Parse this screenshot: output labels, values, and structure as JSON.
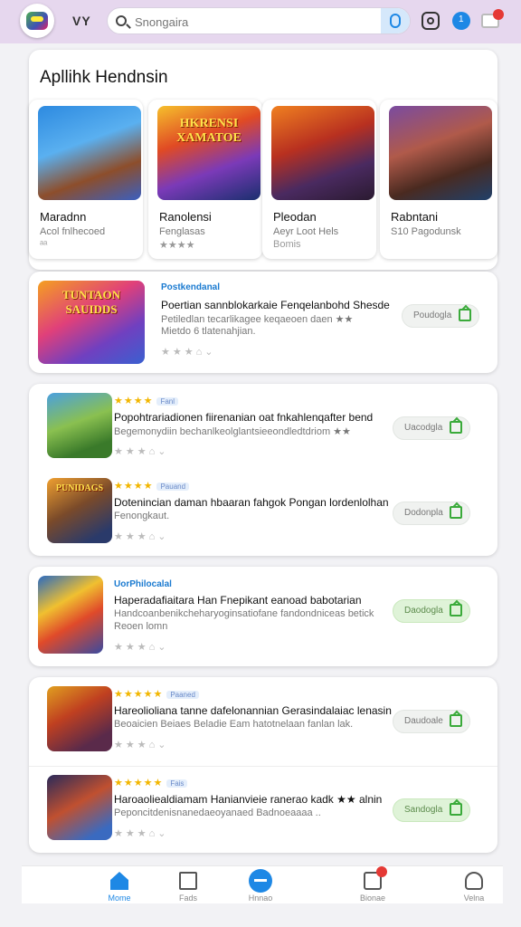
{
  "header": {
    "brand": "VY",
    "search_placeholder": "Snongaira"
  },
  "featured": {
    "title": "Apllihk Hendnsin",
    "cards": [
      {
        "art_text": "",
        "name": "Maradnn",
        "sub": "Acol fnlhecoed",
        "sub2": "ᵃᵃ"
      },
      {
        "art_text": "HKRENSI XAMATOE",
        "name": "Ranolensi",
        "sub": "Fenglasas",
        "sub2": "★★★★"
      },
      {
        "art_text": "",
        "name": "Pleodan",
        "sub": "Aeyr Loot Hels",
        "sub2": "Bomis"
      },
      {
        "art_text": "",
        "name": "Rabntani",
        "sub": "S10 Pagodunsk",
        "sub2": ""
      }
    ]
  },
  "list": [
    {
      "tag": "Postkendanal",
      "title": "Poertian sannblokarkaie Fenqelanbohd Shesde",
      "desc": "Petiledlan tecarlikagee keqaeoen daen ★★",
      "desc2": "Mietdo 6 tlatenahjian.",
      "button": "Poudogla",
      "art_text": "TUNTAON SAUIDDS"
    },
    {
      "stars": "★★★★",
      "badge": "Fanl",
      "title": "Popohtrariadionen fiirenanian oat fnkahlenqafter bend",
      "desc": "Begemonydiin bechanlkeolglantsieeondledtdriom ★★",
      "desc2": "",
      "button": "Uacodgla",
      "art_text": ""
    },
    {
      "stars": "★★★★",
      "badge": "Pauand",
      "title": "Dotenincian daman hbaaran fahgok Pongan lordenlolhan",
      "desc": "Fenongkaut.",
      "desc2": "",
      "button": "Dodonpla",
      "art_text": "PUNIDAGS"
    },
    {
      "tag": "UorPhilocalal",
      "title": "Haperadafiaitara Han Fnepikant eanoad babotarian",
      "desc": "Handcoanbenikcheharyoginsatiofane fandondniceas betick",
      "desc2": "Reoen lomn",
      "button": "Daodogla",
      "art_text": ""
    },
    {
      "stars": "★★★★★",
      "badge": "Paaned",
      "title": "Hareolioliana tanne dafelonannian Gerasindalaiac lenasin",
      "desc": "Beoaicien Beiaes Beladie Eam hatotnelaan fanlan lak.",
      "desc2": "",
      "button": "Daudoale",
      "art_text": ""
    },
    {
      "stars": "★★★★★",
      "badge": "Fais",
      "title": "Haroaoliealdiamam Hanianvieie ranerao kadk ★★ alnin",
      "desc": "Peponcitdenisnanedaeoyanaed Badnoeaaaa ..",
      "desc2": "",
      "button": "Sandogla",
      "art_text": ""
    }
  ],
  "nav": [
    {
      "label": "Mome"
    },
    {
      "label": "Fads"
    },
    {
      "label": "Hnnao"
    },
    {
      "label": "Bionae"
    },
    {
      "label": "Velna"
    }
  ]
}
